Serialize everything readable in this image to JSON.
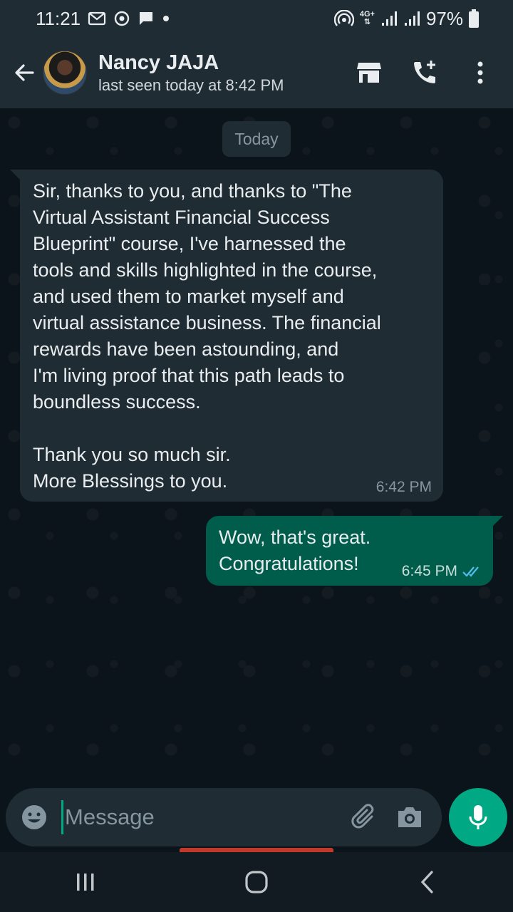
{
  "status_bar": {
    "time": "11:21",
    "network": "4G+",
    "battery": "97%",
    "icons": [
      "gmail-icon",
      "sync-icon",
      "chat-bubble-icon",
      "dot-icon",
      "hotspot-icon",
      "network-type-icon",
      "signal-icon",
      "signal-icon",
      "battery-icon"
    ]
  },
  "header": {
    "contact_name": "Nancy JAJA",
    "last_seen": "last seen today at 8:42 PM",
    "actions": [
      "store-icon",
      "add-call-icon",
      "more-vertical-icon"
    ]
  },
  "chat": {
    "date_chip": "Today",
    "messages": [
      {
        "direction": "incoming",
        "text": "Sir, thanks to you, and thanks to \"The\nVirtual Assistant Financial Success\nBlueprint\" course, I've harnessed the\ntools and skills highlighted in the course,\nand used them to market myself and\nvirtual assistance business. The financial\nrewards have been astounding, and\nI'm living proof that this path leads to\nboundless success.\n\nThank you so much sir.\nMore Blessings to you.",
        "time": "6:42 PM"
      },
      {
        "direction": "outgoing",
        "text": "Wow, that's great.\nCongratulations!",
        "time": "6:45 PM",
        "read_status": "read"
      }
    ]
  },
  "composer": {
    "placeholder": "Message"
  },
  "colors": {
    "header_bg": "#1f2c34",
    "chat_bg": "#0b141a",
    "incoming_bubble": "#1f2c34",
    "outgoing_bubble": "#005c4b",
    "accent": "#00a884",
    "read_ticks": "#53bdeb"
  }
}
